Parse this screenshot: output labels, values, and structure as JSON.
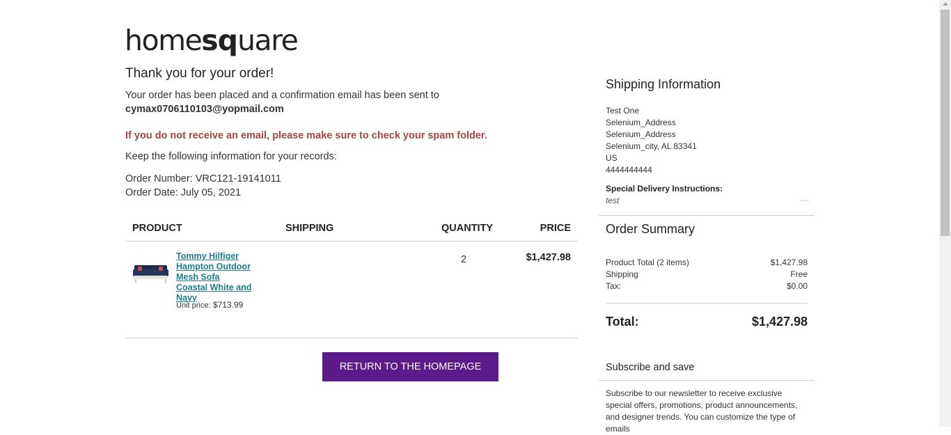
{
  "brand": {
    "logo_pre": "home",
    "logo_sq": "sq",
    "logo_post": "uare"
  },
  "confirmation": {
    "heading": "Thank you for your order!",
    "placed_text": "Your order has been placed and a confirmation email has been sent to",
    "email": "cymax0706110103@yopmail.com",
    "spam_notice": "If you do not receive an email, please make sure to check your spam folder.",
    "keep_text": "Keep the following information for your records:",
    "order_number": "Order Number: VRC121-19141011",
    "order_date": "Order Date: July 05, 2021"
  },
  "table": {
    "headers": {
      "product": "PRODUCT",
      "shipping": "SHIPPING",
      "quantity": "QUANTITY",
      "price": "PRICE"
    },
    "items": [
      {
        "name": "Tommy Hilfiger Hampton Outdoor Mesh Sofa Coastal White and Navy",
        "unit_price_label": "Unit price:",
        "unit_price": "$713.99",
        "quantity": "2",
        "price": "$1,427.98",
        "image_icon": "sofa-image"
      }
    ]
  },
  "actions": {
    "return_home": "RETURN TO THE HOMEPAGE"
  },
  "shipping_info": {
    "title": "Shipping Information",
    "name": "Test One",
    "address1": "Selenium_Address",
    "address2": "Selenium_Address",
    "city_line": "Selenium_city, AL 83341",
    "country": "US",
    "phone": "4444444444",
    "instructions_label": "Special Delivery Instructions:",
    "instructions": "test",
    "more_icon": "more-dots-icon"
  },
  "order_summary": {
    "title": "Order Summary",
    "product_total_label": "Product Total (2 items)",
    "product_total": "$1,427.98",
    "shipping_label": "Shipping",
    "shipping": "Free",
    "tax_label": "Tax:",
    "tax": "$0.00",
    "total_label": "Total:",
    "total": "$1,427.98"
  },
  "subscribe": {
    "title": "Subscribe and save",
    "text": "Subscribe to our newsletter to receive exclusive special offers, promotions, product announcements, and designer trends. You can customize the type of emails"
  },
  "colors": {
    "accent": "#5c1a8a",
    "alert": "#a94442",
    "link": "#1f7d8c"
  }
}
